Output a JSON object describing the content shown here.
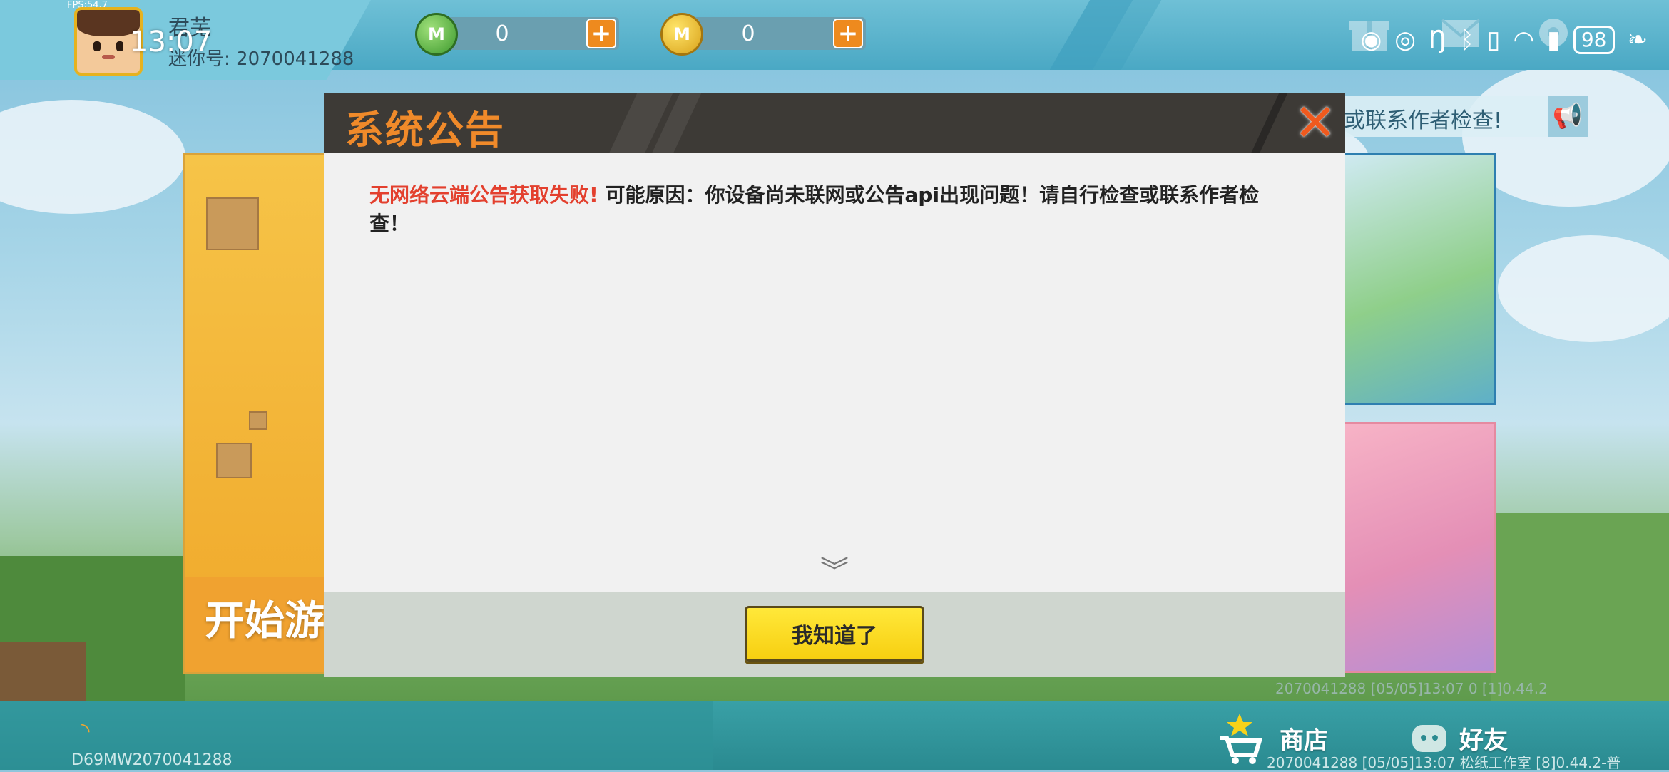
{
  "status_bar": {
    "fps": "FPS:54.7",
    "clock": "13:07",
    "battery": "98"
  },
  "profile": {
    "username": "君芜",
    "user_id": "迷你号: 2070041288"
  },
  "currency": {
    "mini_beans": "0",
    "mini_coins": "0",
    "plus": "+"
  },
  "notice_marquee": "或联系作者检查!",
  "start_card_label": "开始游",
  "modal": {
    "title": "系统公告",
    "close_glyph": "✕",
    "error_text": "无网络云端公告获取失败!",
    "detail_text": "可能原因：你设备尚未联网或公告api出现问题！请自行检查或联系作者检查！",
    "scroll_glyph": "︾",
    "ok_button": "我知道了"
  },
  "bottom_nav": {
    "shop": "商店",
    "friends": "好友"
  },
  "footer": {
    "device_code": "D69MW2070041288",
    "version_upper": "2070041288    [05/05]13:07 0  [1]0.44.2",
    "version_lower": "2070041288    [05/05]13:07 松纸工作室    [8]0.44.2-普"
  },
  "colors": {
    "modal_header": "#3d3a36",
    "modal_title": "#f08a2a",
    "error_red": "#e3402e",
    "ok_button_yellow": "#f7cf10",
    "plus_orange": "#ee8a1e"
  }
}
